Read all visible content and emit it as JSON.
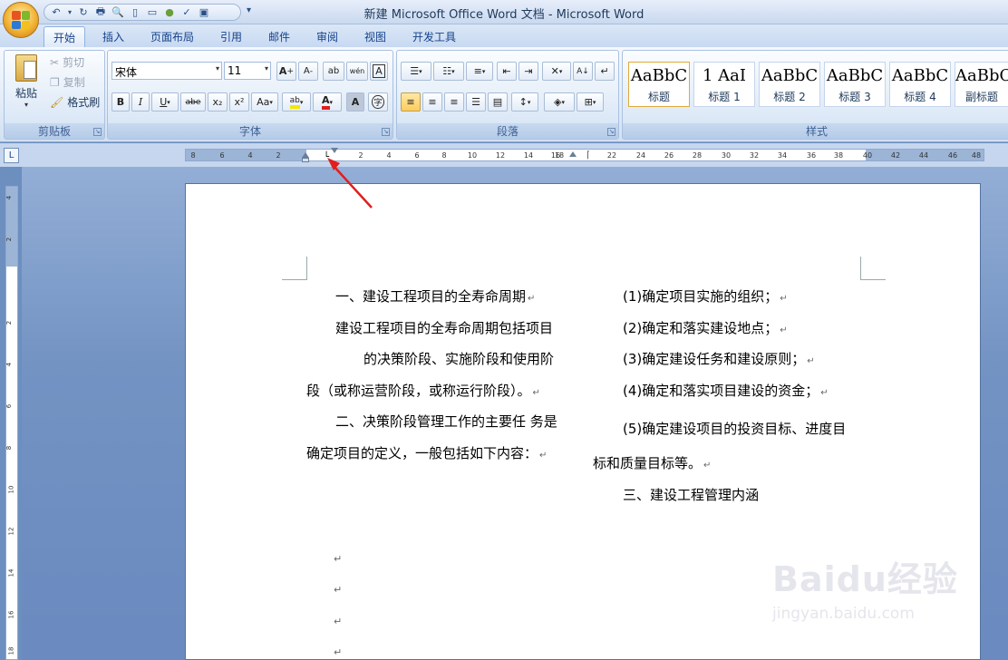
{
  "window": {
    "title": "新建 Microsoft Office Word 文档 - Microsoft Word"
  },
  "quick_access": {
    "menu_glyph": "▾"
  },
  "tabs": [
    {
      "label": "开始",
      "active": true
    },
    {
      "label": "插入"
    },
    {
      "label": "页面布局"
    },
    {
      "label": "引用"
    },
    {
      "label": "邮件"
    },
    {
      "label": "审阅"
    },
    {
      "label": "视图"
    },
    {
      "label": "开发工具"
    }
  ],
  "clipboard": {
    "paste": "粘贴",
    "cut": "剪切",
    "copy": "复制",
    "format_painter": "格式刷",
    "label": "剪贴板"
  },
  "font": {
    "name": "宋体",
    "size": "11",
    "label": "字体",
    "grow": "A",
    "shrink": "A",
    "clear": "ab",
    "phonetic": "wén",
    "border_char": "A",
    "bold": "B",
    "italic": "I",
    "underline": "U",
    "strike": "abe",
    "subscript": "x₂",
    "superscript": "x²",
    "case": "Aa",
    "highlight": "ab",
    "color": "A",
    "shading": "A",
    "enclose": "字"
  },
  "paragraph": {
    "label": "段落"
  },
  "styles": {
    "label": "样式",
    "items": [
      {
        "sample": "AaBbC",
        "name": "标题"
      },
      {
        "sample": "1 AaI",
        "name": "标题 1"
      },
      {
        "sample": "AaBbC",
        "name": "标题 2"
      },
      {
        "sample": "AaBbC",
        "name": "标题 3"
      },
      {
        "sample": "AaBbC",
        "name": "标题 4"
      },
      {
        "sample": "AaBbC",
        "name": "副标题"
      }
    ]
  },
  "ruler": {
    "tab_selector": "L",
    "ticks": [
      "8",
      "6",
      "4",
      "2",
      "2",
      "4",
      "6",
      "8",
      "10",
      "12",
      "14",
      "16",
      "18",
      "22",
      "24",
      "26",
      "28",
      "30",
      "32",
      "34",
      "36",
      "38",
      "40",
      "42",
      "44",
      "46",
      "48"
    ]
  },
  "vruler": {
    "ticks": [
      "4",
      "2",
      "2",
      "4",
      "6",
      "8",
      "10",
      "12",
      "14",
      "16",
      "18"
    ]
  },
  "document": {
    "left_col": [
      "一、建设工程项目的全寿命周期",
      "建设工程项目的全寿命周期包括项目",
      "的决策阶段、实施阶段和使用阶",
      "段（或称运营阶段，或称运行阶段）。",
      "二、决策阶段管理工作的主要任 务是",
      "确定项目的定义，一般包括如下内容："
    ],
    "right_col": [
      "(1)确定项目实施的组织；",
      "(2)确定和落实建设地点；",
      "(3)确定建设任务和建设原则；",
      "(4)确定和落实项目建设的资金；",
      "(5)确定建设项目的投资目标、进度目",
      "标和质量目标等。",
      "三、建设工程管理内涵"
    ],
    "paragraph_mark": "↵"
  },
  "watermark": {
    "brand": "Baidu经验",
    "url": "jingyan.baidu.com"
  },
  "colors": {
    "accent": "#15428b",
    "arrow": "#e01e1e",
    "ribbon_bg": "#dfe9f7"
  }
}
